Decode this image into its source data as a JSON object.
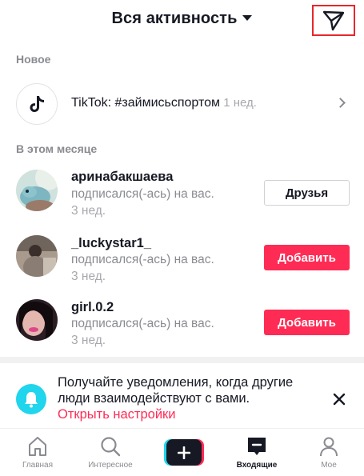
{
  "header": {
    "title": "Вся активность",
    "dm_icon": "paper-plane-icon"
  },
  "sections": {
    "new_label": "Новое",
    "month_label": "В этом месяце"
  },
  "new_item": {
    "account": "TikTok:",
    "hashtag": " #займисьспортом",
    "time": " 1 нед."
  },
  "activity": [
    {
      "username": "аринабакшаева",
      "action": "подписался(-ась) на вас.",
      "time": "3 нед.",
      "button": "Друзья",
      "button_style": "outline"
    },
    {
      "username": "_luckystar1_",
      "action": "подписался(-ась) на вас.",
      "time": "3 нед.",
      "button": "Добавить",
      "button_style": "primary"
    },
    {
      "username": "girl.0.2",
      "action": "подписался(-ась) на вас.",
      "time": "3 нед.",
      "button": "Добавить",
      "button_style": "primary"
    }
  ],
  "notification": {
    "text": "Получайте уведомления, когда другие люди взаимодействуют с вами.",
    "link": "Открыть настройки"
  },
  "tabs": [
    {
      "label": "Главная",
      "icon": "home-icon"
    },
    {
      "label": "Интересное",
      "icon": "search-icon"
    },
    {
      "label": "",
      "icon": "plus-icon"
    },
    {
      "label": "Входящие",
      "icon": "inbox-icon"
    },
    {
      "label": "Мое",
      "icon": "profile-icon"
    }
  ],
  "colors": {
    "accent_red": "#fe2c55",
    "accent_cyan": "#20d5ec",
    "text_primary": "#161823",
    "text_muted": "#8a8b91",
    "highlight_box": "#e8262b"
  }
}
